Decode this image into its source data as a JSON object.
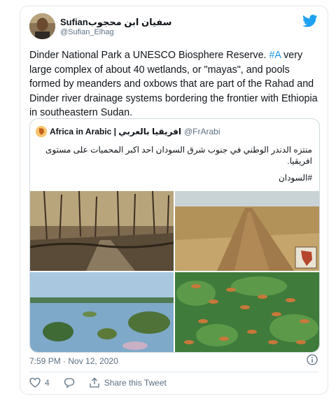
{
  "tweet": {
    "author_name": "Sufianسفيان ابن محجوب",
    "author_handle": "@Sufian_Elhag",
    "text_before": "Dinder National Park a UNESCO Biosphere Reserve. ",
    "hashtag": "#A",
    "text_after": " very large complex of about 40 wetlands, or \"mayas\", and pools formed by meanders and oxbows that are part of the Rahad and Dinder river drainage systems bordering the frontier with Ethiopia in southeastern Sudan.",
    "timestamp": "7:59 PM · Nov 12, 2020"
  },
  "quote": {
    "name": "Africa in Arabic | افريقيا بالعربي",
    "handle": "@FrArabi",
    "text": "منتزه الدندر الوطني في جنوب شرق السودان احد اكبر المحميات على مستوى افريقيا.",
    "hashtag": "#السودان"
  },
  "actions": {
    "likes": "4",
    "share_label": "Share this Tweet"
  },
  "icons": {
    "logo": "twitter-bird-icon",
    "info": "info-icon",
    "like": "heart-icon",
    "reply": "reply-bubble-icon",
    "share": "share-icon"
  },
  "colors": {
    "twitter_blue": "#1da1f2",
    "hashtag": "#1b95e0",
    "secondary_text": "#5b7083",
    "border": "#e1e8ed"
  }
}
